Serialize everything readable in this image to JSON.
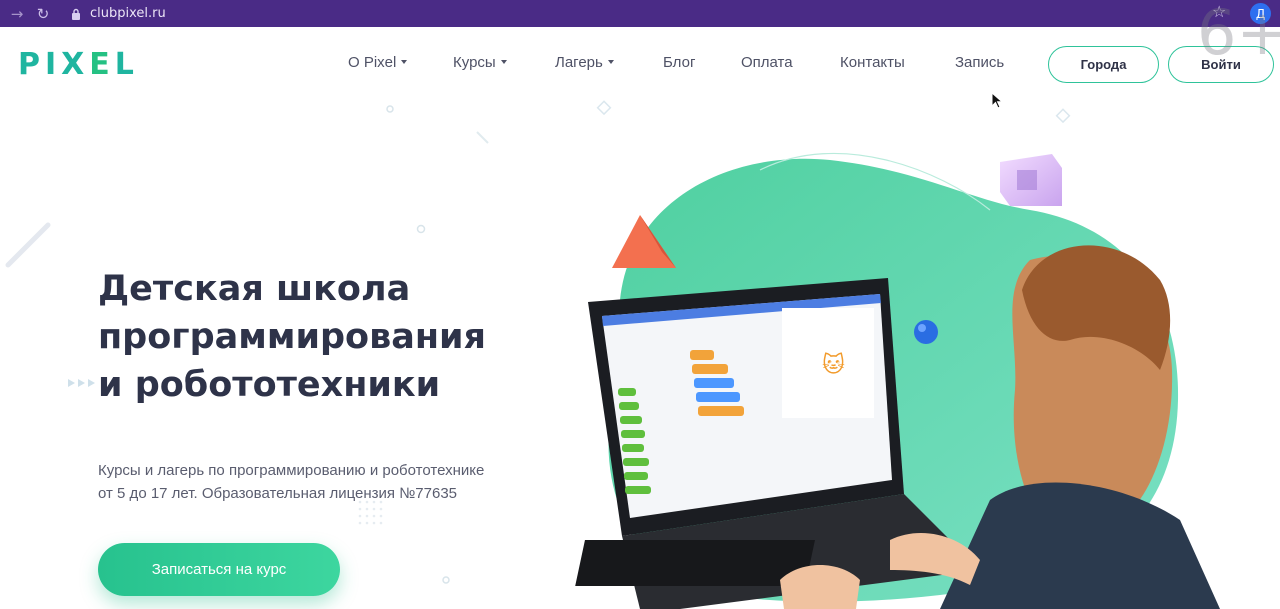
{
  "browser": {
    "url": "clubpixel.ru",
    "profile_initial": "Д"
  },
  "header": {
    "logo": "PIXEL",
    "nav": [
      {
        "label": "О Pixel",
        "has_dropdown": true
      },
      {
        "label": "Курсы",
        "has_dropdown": true
      },
      {
        "label": "Лагерь",
        "has_dropdown": true
      },
      {
        "label": "Блог",
        "has_dropdown": false
      },
      {
        "label": "Оплата",
        "has_dropdown": false
      },
      {
        "label": "Контакты",
        "has_dropdown": false
      },
      {
        "label": "Запись",
        "has_dropdown": false
      }
    ],
    "cities_button": "Города",
    "login_button": "Войти",
    "age_rating": "6+"
  },
  "hero": {
    "title_lines": [
      "Детская школа",
      "программирования",
      "и робототехники"
    ],
    "subtitle_lines": [
      "Курсы и лагерь по программированию и робототехнике",
      "от 5 до 17 лет. Образовательная лицензия №77635"
    ],
    "cta_button": "Записаться на курс"
  },
  "colors": {
    "browser_bar": "#4a2b86",
    "accent_green": "#2fc39a",
    "title": "#2e3349",
    "blob": "#5ed3a8"
  },
  "icons": [
    "forward-arrow-icon",
    "reload-icon",
    "lock-icon",
    "star-icon",
    "caret-down-icon",
    "mouse-cursor-icon"
  ]
}
